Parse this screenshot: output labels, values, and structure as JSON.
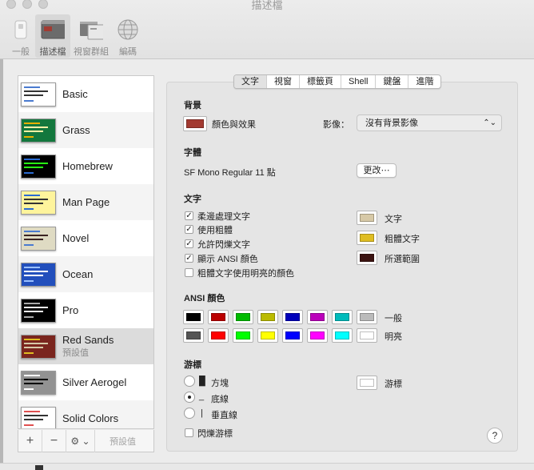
{
  "window": {
    "title": "描述檔"
  },
  "toolbar": {
    "items": [
      {
        "label": "一般",
        "icon": "switch-icon"
      },
      {
        "label": "描述檔",
        "icon": "terminal-profiles-icon"
      },
      {
        "label": "視窗群組",
        "icon": "window-groups-icon"
      },
      {
        "label": "編碼",
        "icon": "globe-icon"
      }
    ]
  },
  "profiles": [
    {
      "name": "Basic",
      "bg": "#ffffff",
      "fg": "#333333",
      "accent": "#4a7bd0"
    },
    {
      "name": "Grass",
      "bg": "#13773d",
      "fg": "#fff0a5",
      "accent": "#e7b000"
    },
    {
      "name": "Homebrew",
      "bg": "#000000",
      "fg": "#28fe14",
      "accent": "#2a6bd1"
    },
    {
      "name": "Man Page",
      "bg": "#fef49c",
      "fg": "#333333",
      "accent": "#2a6bd1"
    },
    {
      "name": "Novel",
      "bg": "#dfdbc3",
      "fg": "#3b2322",
      "accent": "#4a7bd0"
    },
    {
      "name": "Ocean",
      "bg": "#224fbc",
      "fg": "#ffffff",
      "accent": "#9ac0ff"
    },
    {
      "name": "Pro",
      "bg": "#000000",
      "fg": "#f2f2f2",
      "accent": "#aaaaaa"
    },
    {
      "name": "Red Sands",
      "subtitle": "預設值",
      "bg": "#7a251e",
      "fg": "#d7c9a7",
      "accent": "#dfbd22"
    },
    {
      "name": "Silver Aerogel",
      "bg": "#929292",
      "fg": "#000000",
      "accent": "#ffffff"
    },
    {
      "name": "Solid Colors",
      "bg": "#ffffff",
      "fg": "#333333",
      "accent": "#e05050"
    }
  ],
  "list_bar": {
    "add": "+",
    "remove": "−",
    "gear": "⚙ ⌄",
    "default_label": "預設值"
  },
  "tabs": [
    "文字",
    "視窗",
    "標籤頁",
    "Shell",
    "鍵盤",
    "進階"
  ],
  "active_tab": "文字",
  "background": {
    "section": "背景",
    "color_effect_label": "顏色與效果",
    "color": "#a33a31",
    "image_label": "影像：",
    "image_value": "沒有背景影像"
  },
  "font": {
    "section": "字體",
    "value": "SF Mono Regular 11 點",
    "change_button": "更改⋯"
  },
  "text": {
    "section": "文字",
    "options": [
      {
        "label": "柔邊處理文字",
        "checked": true
      },
      {
        "label": "使用粗體",
        "checked": true
      },
      {
        "label": "允許閃爍文字",
        "checked": true
      },
      {
        "label": "顯示 ANSI 顏色",
        "checked": true
      },
      {
        "label": "粗體文字使用明亮的顏色",
        "checked": false
      }
    ],
    "colors": [
      {
        "label": "文字",
        "color": "#d7c9a7"
      },
      {
        "label": "粗體文字",
        "color": "#dfbd22"
      },
      {
        "label": "所選範圍",
        "color": "#3b1311"
      }
    ]
  },
  "ansi": {
    "section": "ANSI 顏色",
    "normal_label": "一般",
    "bright_label": "明亮",
    "normal": [
      "#000000",
      "#bb0000",
      "#00bb00",
      "#bbbb00",
      "#0000bb",
      "#bb00bb",
      "#00bbbb",
      "#bbbbbb"
    ],
    "bright": [
      "#555555",
      "#ff0000",
      "#00ff00",
      "#ffff00",
      "#0000ff",
      "#ff00ff",
      "#00ffff",
      "#ffffff"
    ]
  },
  "cursor": {
    "section": "游標",
    "options": [
      {
        "glyph": "█",
        "label": "方塊",
        "selected": false
      },
      {
        "glyph": "_",
        "label": "底線",
        "selected": true
      },
      {
        "glyph": "|",
        "label": "垂直線",
        "selected": false
      }
    ],
    "blink_label": "閃爍游標",
    "blink_checked": false,
    "color_label": "游標",
    "color": "#ffffff"
  },
  "help": "?"
}
